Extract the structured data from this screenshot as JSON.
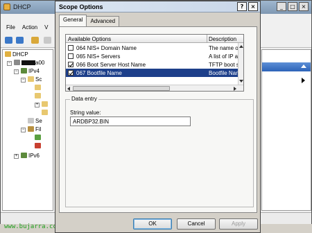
{
  "background_window": {
    "title": "DHCP",
    "window_buttons": [
      "_",
      "□",
      "×"
    ],
    "menu": [
      "File",
      "Action",
      "V"
    ],
    "tree": [
      {
        "label": "DHCP",
        "icon": "dhcp-icon"
      },
      {
        "label": "a00",
        "icon": "server-icon",
        "prefix": "redacted"
      },
      {
        "label": "IPv4",
        "icon": "ipv4-icon"
      },
      {
        "label": "Sc",
        "icon": "folder-icon"
      },
      {
        "label": "Se",
        "icon": "folder-icon"
      },
      {
        "label": "Fil",
        "icon": "filter-icon"
      },
      {
        "label": "IPv6",
        "icon": "ipv6-icon"
      }
    ]
  },
  "dialog": {
    "title": "Scope Options",
    "help_button": "?",
    "close_button": "×",
    "tabs": [
      {
        "label": "General",
        "active": true
      },
      {
        "label": "Advanced",
        "active": false
      }
    ],
    "list": {
      "col_available": "Available Options",
      "col_description": "Description",
      "rows": [
        {
          "name": "064 NIS+ Domain Name",
          "desc": "The name o",
          "checked": false,
          "selected": false
        },
        {
          "name": "065 NIS+ Servers",
          "desc": "A list of IP a",
          "checked": false,
          "selected": false
        },
        {
          "name": "066 Boot Server Host Name",
          "desc": "TFTP boot s",
          "checked": true,
          "selected": false
        },
        {
          "name": "067 Bootfile Name",
          "desc": "Bootfile Nam",
          "checked": true,
          "selected": true
        }
      ]
    },
    "data_entry": {
      "legend": "Data entry",
      "string_label": "String value:",
      "string_value": "ARDBP32.BIN"
    },
    "buttons": {
      "ok": "OK",
      "cancel": "Cancel",
      "apply": "Apply"
    }
  },
  "watermark": "www.bujarra.com",
  "colors": {
    "selection": "#1d3f8a",
    "watermark": "#1fa01f"
  }
}
